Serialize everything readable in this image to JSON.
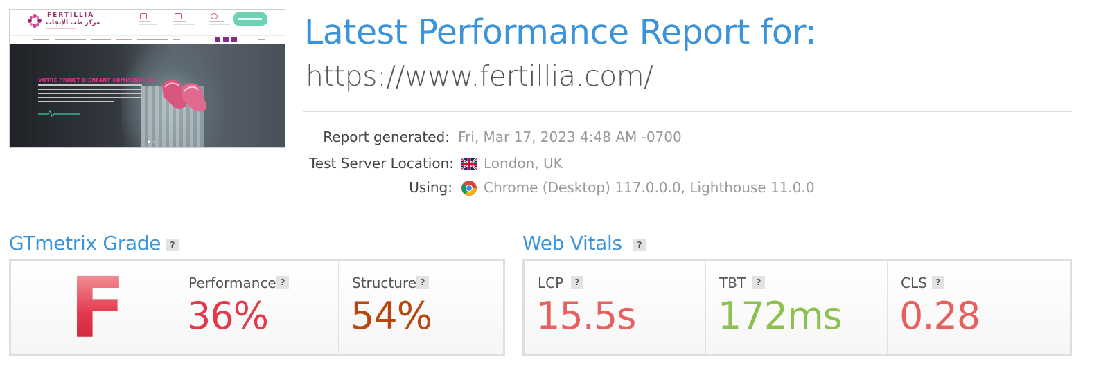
{
  "thumbnail": {
    "logo_text": "FERTILLIA",
    "logo_arabic": "مركز طب الإنجاب",
    "hero_title": "VOTRE PROJET D'ENFANT COMMENCE ICI",
    "colors": {
      "brand": "#9b2a6e",
      "accent": "#e0328a",
      "cta": "#6fd2b5"
    }
  },
  "header": {
    "title": "Latest Performance Report for:",
    "url": "https://www.fertillia.com/"
  },
  "meta": {
    "report_generated_label": "Report generated:",
    "report_generated_value": "Fri, Mar 17, 2023 4:48 AM -0700",
    "location_label": "Test Server Location:",
    "location_flag_icon": "uk-flag-icon",
    "location_value": "London, UK",
    "using_label": "Using:",
    "using_icon": "chrome-icon",
    "using_value": "Chrome (Desktop) 117.0.0.0, Lighthouse 11.0.0"
  },
  "grade": {
    "section_title": "GTmetrix Grade",
    "help": "?",
    "letter": "F",
    "performance_label": "Performance",
    "performance_value": "36%",
    "structure_label": "Structure",
    "structure_value": "54%",
    "colors": {
      "grade": "#e2394b",
      "performance": "#e2394b",
      "structure": "#b8460f"
    }
  },
  "vitals": {
    "section_title": "Web Vitals",
    "help": "?",
    "lcp_label": "LCP",
    "lcp_value": "15.5s",
    "tbt_label": "TBT",
    "tbt_value": "172ms",
    "cls_label": "CLS",
    "cls_value": "0.28",
    "colors": {
      "lcp": "#e8605e",
      "tbt": "#8cc04f",
      "cls": "#e8605e"
    }
  }
}
